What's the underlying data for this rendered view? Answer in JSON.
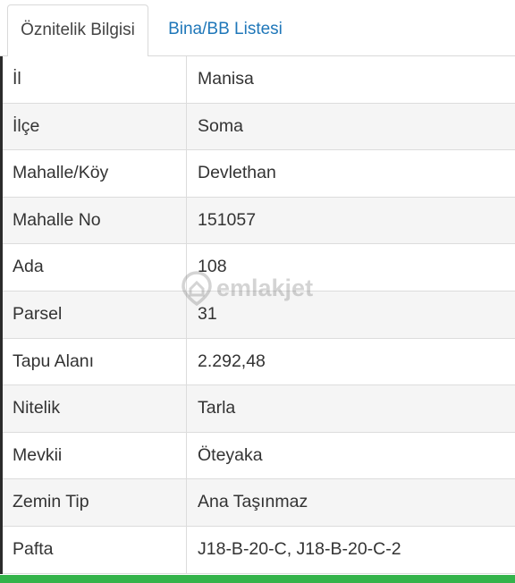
{
  "tabs": [
    {
      "label": "Öznitelik Bilgisi",
      "active": true
    },
    {
      "label": "Bina/BB Listesi",
      "active": false
    }
  ],
  "rows": [
    {
      "key": "İl",
      "value": "Manisa"
    },
    {
      "key": "İlçe",
      "value": "Soma"
    },
    {
      "key": "Mahalle/Köy",
      "value": "Devlethan"
    },
    {
      "key": "Mahalle No",
      "value": "151057"
    },
    {
      "key": "Ada",
      "value": "108"
    },
    {
      "key": "Parsel",
      "value": "31"
    },
    {
      "key": "Tapu Alanı",
      "value": "2.292,48"
    },
    {
      "key": "Nitelik",
      "value": "Tarla"
    },
    {
      "key": "Mevkii",
      "value": "Öteyaka"
    },
    {
      "key": "Zemin Tip",
      "value": "Ana Taşınmaz"
    },
    {
      "key": "Pafta",
      "value": "J18-B-20-C, J18-B-20-C-2"
    }
  ],
  "watermark": {
    "text": "emlakjet",
    "icon": "home-pin-icon"
  },
  "colors": {
    "tab_link": "#1f77b9",
    "footer_bar": "#33b34a",
    "row_alt": "#f5f5f5",
    "border": "#dcdcdc"
  }
}
